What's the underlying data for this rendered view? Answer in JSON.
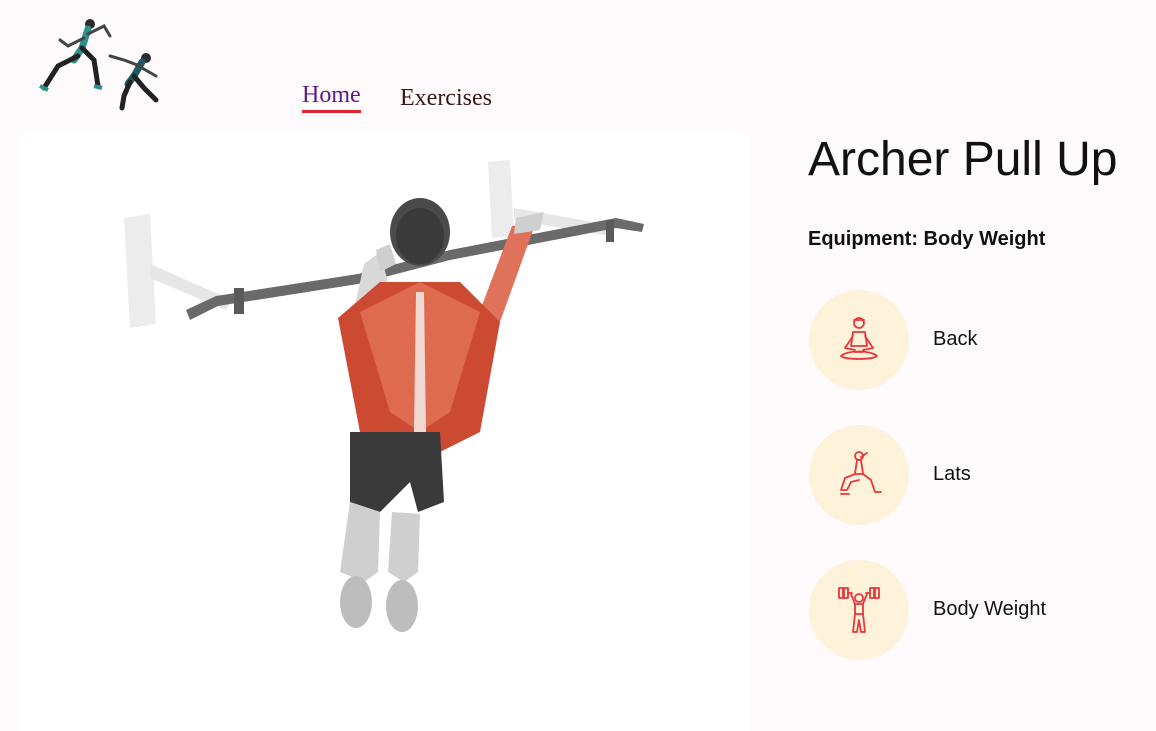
{
  "header": {
    "logo_icon": "runners-logo-icon",
    "nav": {
      "home_label": "Home",
      "exercises_label": "Exercises"
    }
  },
  "exercise": {
    "name": "Archer Pull Up",
    "equipment_text": "Equipment: Body Weight",
    "image_icon": "archer-pull-up-illustration",
    "details": [
      {
        "label": "Back",
        "icon": "meditation-pose-icon"
      },
      {
        "label": "Lats",
        "icon": "lunge-pose-icon"
      },
      {
        "label": "Body Weight",
        "icon": "dumbbell-lift-icon"
      }
    ]
  },
  "colors": {
    "page_bg": "#fffafb",
    "accent_red": "#e0242f",
    "home_link": "#5b1a86",
    "icon_circle": "#fff2da",
    "icon_stroke": "#e8363d"
  }
}
